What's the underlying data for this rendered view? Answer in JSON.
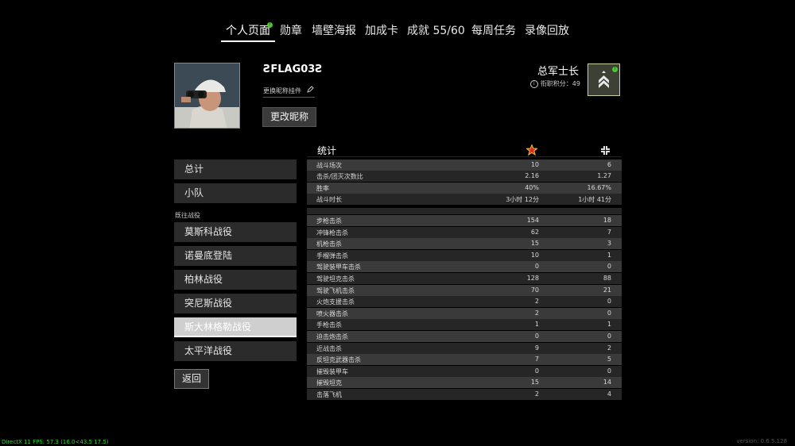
{
  "nav": {
    "tabs": [
      "个人页面",
      "勋章",
      "墙壁海报",
      "加成卡",
      "成就 55/60",
      "每周任务",
      "录像回放"
    ],
    "badge": "!"
  },
  "profile": {
    "name": "ƧFLAG03Ƨ",
    "nickname_decoration": "更换昵称挂件",
    "rename_button": "更改昵称",
    "rank_title": "总军士长",
    "rank_points": "衔职积分：49",
    "rank_badge_dot": "!"
  },
  "sidebar": {
    "top": [
      "总计",
      "小队"
    ],
    "section_label": "既往战役",
    "campaigns": [
      "莫斯科战役",
      "诺曼底登陆",
      "柏林战役",
      "突尼斯战役",
      "斯大林格勒战役",
      "太平洋战役"
    ],
    "selected": "斯大林格勒战役",
    "back": "返回"
  },
  "stats": {
    "title": "统计",
    "col1_icon": "red-star-icon",
    "col2_icon": "squad-icon",
    "group1": [
      {
        "label": "战斗场次",
        "v1": "10",
        "v2": "6"
      },
      {
        "label": "击杀/团灭次数比",
        "v1": "2.16",
        "v2": "1.27"
      },
      {
        "label": "胜率",
        "v1": "40%",
        "v2": "16.67%"
      },
      {
        "label": "战斗时长",
        "v1": "3小时 12分",
        "v2": "1小时 41分"
      }
    ],
    "group2": [
      {
        "label": "步枪击杀",
        "v1": "154",
        "v2": "18"
      },
      {
        "label": "冲锋枪击杀",
        "v1": "62",
        "v2": "7"
      },
      {
        "label": "机枪击杀",
        "v1": "15",
        "v2": "3"
      },
      {
        "label": "手榴弹击杀",
        "v1": "10",
        "v2": "1"
      },
      {
        "label": "驾驶装甲车击杀",
        "v1": "0",
        "v2": "0"
      },
      {
        "label": "驾驶坦克击杀",
        "v1": "128",
        "v2": "88"
      },
      {
        "label": "驾驶飞机击杀",
        "v1": "70",
        "v2": "21"
      },
      {
        "label": "火炮支援击杀",
        "v1": "2",
        "v2": "0"
      },
      {
        "label": "喷火器击杀",
        "v1": "2",
        "v2": "0"
      },
      {
        "label": "手枪击杀",
        "v1": "1",
        "v2": "1"
      },
      {
        "label": "迫击炮击杀",
        "v1": "0",
        "v2": "0"
      },
      {
        "label": "近战击杀",
        "v1": "9",
        "v2": "2"
      },
      {
        "label": "反坦克武器击杀",
        "v1": "7",
        "v2": "5"
      },
      {
        "label": "摧毁装甲车",
        "v1": "0",
        "v2": "0"
      },
      {
        "label": "摧毁坦克",
        "v1": "15",
        "v2": "14"
      },
      {
        "label": "击落飞机",
        "v1": "2",
        "v2": "4"
      }
    ]
  },
  "footer": {
    "fps": "DirectX 11 FPS: 57.3 (16.0<43.5 17.5)",
    "version": "version: 0.6.5.128"
  }
}
